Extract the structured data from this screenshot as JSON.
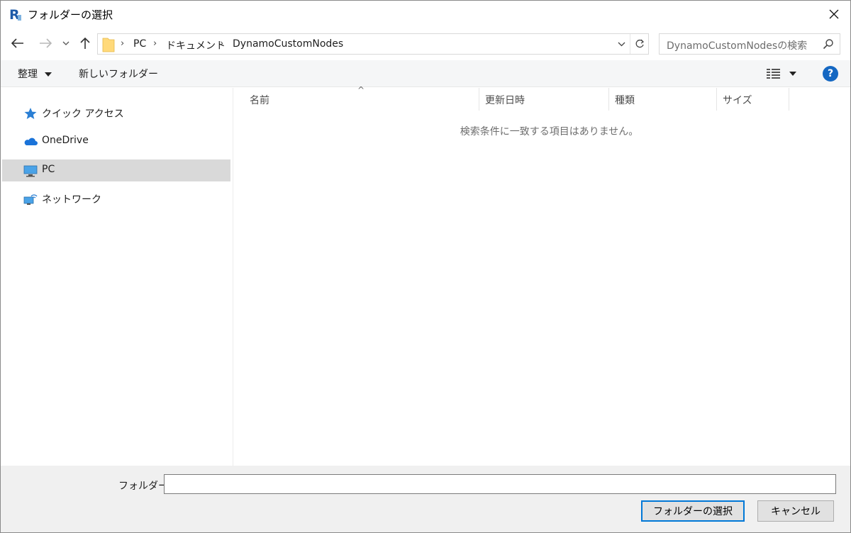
{
  "window": {
    "title": "フォルダーの選択"
  },
  "address": {
    "crumbs": [
      "PC",
      "ドキュメント",
      "DynamoCustomNodes"
    ]
  },
  "search": {
    "placeholder": "DynamoCustomNodesの検索"
  },
  "toolbar": {
    "organize_label": "整理",
    "new_folder_label": "新しいフォルダー",
    "help_label": "?"
  },
  "nav": {
    "items": [
      {
        "label": "クイック アクセス",
        "icon": "quick-access-star-icon"
      },
      {
        "label": "OneDrive",
        "icon": "onedrive-cloud-icon"
      },
      {
        "label": "PC",
        "icon": "pc-monitor-icon"
      },
      {
        "label": "ネットワーク",
        "icon": "network-icon"
      }
    ]
  },
  "columns": [
    "名前",
    "更新日時",
    "種類",
    "サイズ"
  ],
  "content": {
    "empty_message": "検索条件に一致する項目はありません。"
  },
  "footer": {
    "folder_label": "フォルダー:",
    "folder_value": "",
    "select_button": "フォルダーの選択",
    "cancel_button": "キャンセル"
  },
  "colors": {
    "accent": "#0078d7",
    "help": "#1467c2",
    "selected_nav": "#d9d9d9"
  }
}
